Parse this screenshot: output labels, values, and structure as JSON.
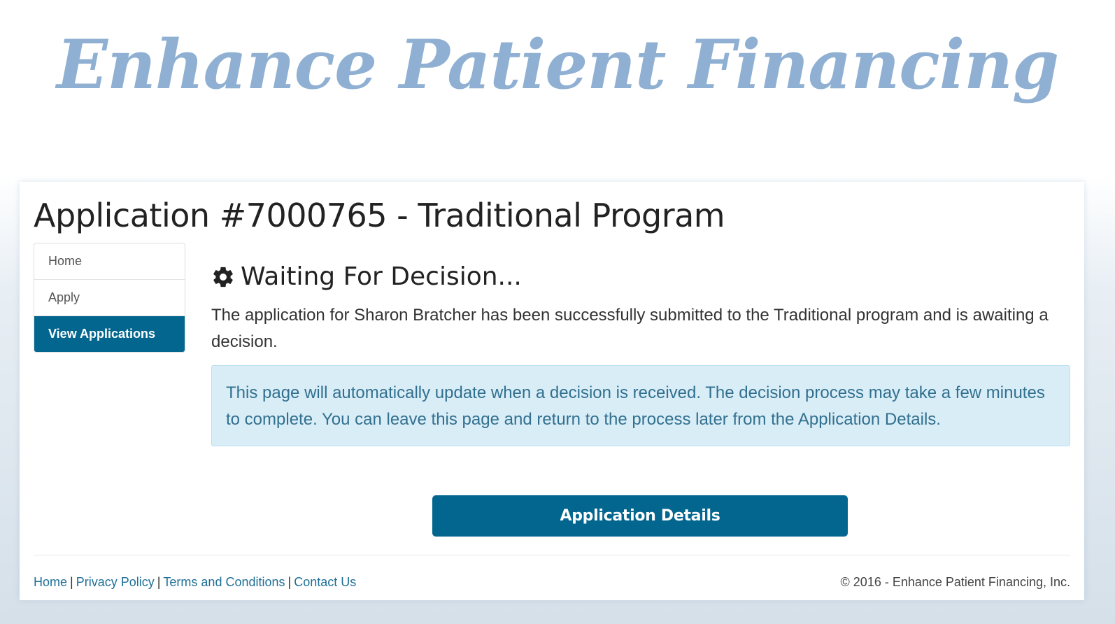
{
  "brand": {
    "logo_text": "Enhance Patient Financing",
    "color": "#8fb0d2"
  },
  "page": {
    "title": "Application #7000765 - Traditional Program"
  },
  "sidebar": {
    "items": [
      {
        "label": "Home",
        "active": false
      },
      {
        "label": "Apply",
        "active": false
      },
      {
        "label": "View Applications",
        "active": true
      }
    ],
    "active_color": "#03668f"
  },
  "status": {
    "icon": "gear-icon",
    "heading": "Waiting For Decision...",
    "message": "The application for Sharon Bratcher has been successfully submitted to the Traditional program and is awaiting a decision."
  },
  "alert": {
    "text": "This page will automatically update when a decision is received. The decision process may take a few minutes to complete. You can leave this page and return to the process later from the Application Details.",
    "background": "#d9edf7",
    "text_color": "#31708f"
  },
  "actions": {
    "details_button_label": "Application Details"
  },
  "footer": {
    "links": [
      "Home",
      "Privacy Policy",
      "Terms and Conditions",
      "Contact Us"
    ],
    "separator": "|",
    "copyright": "© 2016 - Enhance Patient Financing, Inc."
  }
}
